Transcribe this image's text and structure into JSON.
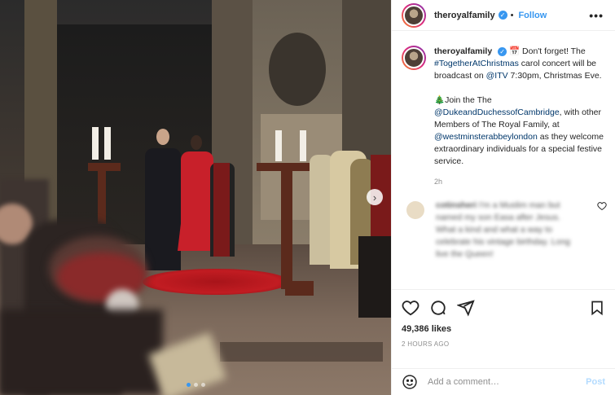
{
  "header": {
    "username": "theroyalfamily",
    "follow_label": "Follow",
    "more_label": "•••"
  },
  "caption": {
    "username": "theroyalfamily",
    "line1_pre": "📅 Don't forget! The ",
    "hashtag": "#TogetherAtChristmas",
    "line1_post": " carol concert will be broadcast on ",
    "mention_itv": "@ITV",
    "line1_end": " 7:30pm, Christmas Eve.",
    "line2_pre": "🎄Join the The ",
    "mention_cambridge": "@DukeandDuchessofCambridge",
    "line2_mid": ", with other Members of The Royal Family, at ",
    "mention_abbey": "@westminsterabbeylondon",
    "line2_end": " as they welcome extraordinary individuals for a special festive service.",
    "time": "2h"
  },
  "comment": {
    "username": "cotinsheri",
    "text": " I'm a Muslim man but named my son Easa after Jesus. What a kind and what a way to celebrate his vintage birthday. Long live the Queen!"
  },
  "engagement": {
    "likes": "49,386 likes",
    "posted": "2 HOURS AGO"
  },
  "add_comment": {
    "placeholder": "Add a comment…",
    "post_label": "Post"
  },
  "carousel": {
    "next_label": "›",
    "dots": 3,
    "active_dot": 0
  },
  "colors": {
    "accent": "#3897f0",
    "link": "#00376b",
    "muted": "#8e8e8e"
  }
}
